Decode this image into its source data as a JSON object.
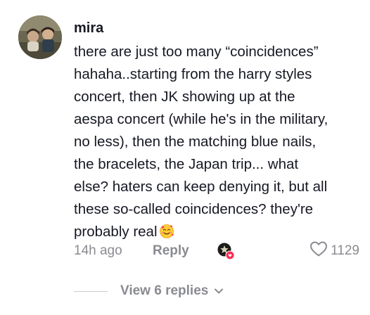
{
  "comment": {
    "username": "mira",
    "lines": [
      "there are just too many “coincidences”",
      "hahaha..starting from the harry styles",
      "concert, then JK showing up at the",
      "aespa concert (while he's in the military,",
      "no less), then the matching blue nails,",
      "the bracelets, the Japan trip... what",
      "else? haters can keep denying it, but all",
      "these so-called coincidences? they're",
      "probably real"
    ],
    "emoji": "smiling-face-with-hearts",
    "timestamp": "14h ago",
    "reply_label": "Reply",
    "like_count": "1129"
  },
  "replies": {
    "label": "View 6 replies"
  },
  "colors": {
    "text": "#161823",
    "muted": "#8a8b91",
    "like_badge": "#fe2c55"
  }
}
